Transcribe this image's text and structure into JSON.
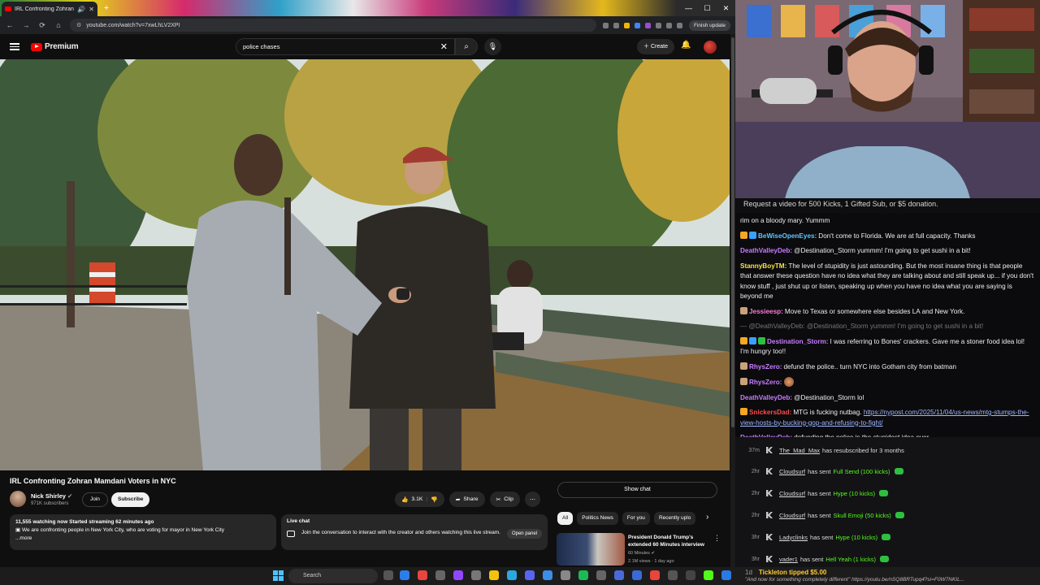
{
  "browser": {
    "tab_title": "IRL Confronting Zohran Ma",
    "url": "youtube.com/watch?v=7xwLhLV2XPI",
    "finish_update": "Finish update"
  },
  "youtube": {
    "logo_text": "Premium",
    "search_value": "police chases",
    "create_label": "Create",
    "video_title": "IRL Confronting Zohran Mamdani Voters in NYC",
    "channel_name": "Nick Shirley",
    "channel_subs": "971K subscribers",
    "join_label": "Join",
    "subscribe_label": "Subscribe",
    "likes": "3.1K",
    "share_label": "Share",
    "clip_label": "Clip",
    "desc_meta": "11,555 watching now  Started streaming 62 minutes ago",
    "desc_text": "We are confronting people in New York City, who are voting for mayor in New York City",
    "desc_more": "...more",
    "livechat_title": "Live chat",
    "livechat_text": "Join the conversation to interact with the creator and others watching this live stream.",
    "open_panel": "Open panel",
    "show_chat": "Show chat",
    "chips": [
      "All",
      "Politics News",
      "For you",
      "Recently uplo"
    ],
    "rec_title": "President Donald Trump's extended 60 Minutes interview",
    "rec_channel": "60 Minutes",
    "rec_views": "2.1M views · 1 day ago"
  },
  "banner_text": "Request a video for 500 Kicks, 1 Gifted Sub, or $5 donation.",
  "chat": [
    {
      "user": "",
      "color": "#efeff1",
      "text": "rim on a bloody mary. Yummm",
      "badges": []
    },
    {
      "user": "BeWiseOpenEyes:",
      "color": "#5ec8ff",
      "text": "Don't come to Florida. We are at full capacity. Thanks",
      "badges": [
        "#f5a623",
        "#3aa0ff"
      ]
    },
    {
      "user": "DeathValleyDeb:",
      "color": "#c77dff",
      "text": "@Destination_Storm yummm! I'm going to get sushi in a bit!",
      "badges": []
    },
    {
      "user": "StannyBoyTM:",
      "color": "#f8e34a",
      "text": "The level of stupidity is just astounding. But the most insane thing is that people that answer these question have no idea what they are talking about and still speak up... if you don't know stuff , just shut up or listen, speaking up when you have no idea what you are saying is beyond me",
      "badges": []
    },
    {
      "user": "Jessieesp:",
      "color": "#ff77d9",
      "text": "Move to Texas or somewhere else besides LA and New York.",
      "badges": [
        "#c9a27a"
      ]
    },
    {
      "user": "",
      "color": "#777",
      "text": "— @DeathValleyDeb: @Destination_Storm yummm! I'm going to get sushi in a bit!",
      "badges": [],
      "dim": true
    },
    {
      "user": "Destination_Storm:",
      "color": "#c77dff",
      "text": "I was referring to Bones' crackers. Gave me a stoner food idea lol! I'm hungry too!!",
      "badges": [
        "#f5a623",
        "#3aa0ff",
        "#2fbf3f"
      ]
    },
    {
      "user": "RhysZero:",
      "color": "#c77dff",
      "text": "defund the police.. turn NYC into Gotham city from batman",
      "badges": [
        "#c9a27a"
      ]
    },
    {
      "user": "RhysZero:",
      "color": "#c77dff",
      "text": "",
      "badges": [
        "#c9a27a"
      ],
      "emote": true
    },
    {
      "user": "DeathValleyDeb:",
      "color": "#c77dff",
      "text": "@Destination_Storm lol",
      "badges": []
    },
    {
      "user": "SnickersDad:",
      "color": "#ff4a4a",
      "text": "MTG is fucking nutbag.",
      "link": "https://nypost.com/2025/11/04/us-news/mtg-stumps-the-view-hosts-by-bucking-gop-and-refusing-to-fight/",
      "badges": [
        "#f5a623"
      ]
    },
    {
      "user": "DeathValleyDeb:",
      "color": "#c77dff",
      "text": "defunding the police is the stupidest idea ever",
      "badges": []
    }
  ],
  "feed": [
    {
      "time": "37m",
      "user": "The_Mad_Max",
      "action": "has resubscribed for 3 months",
      "item": "",
      "gem": false
    },
    {
      "time": "2hr",
      "user": "Cloudsurf",
      "action": "has sent",
      "item": "Full Send (100 kicks)",
      "gem": true
    },
    {
      "time": "2hr",
      "user": "Cloudsurf",
      "action": "has sent",
      "item": "Hype (10 kicks)",
      "gem": true
    },
    {
      "time": "2hr",
      "user": "Cloudsurf",
      "action": "has sent",
      "item": "Skull Emoji (50 kicks)",
      "gem": true
    },
    {
      "time": "3hr",
      "user": "Ladyclinks",
      "action": "has sent",
      "item": "Hype (10 kicks)",
      "gem": true
    },
    {
      "time": "3hr",
      "user": "vader1",
      "action": "has sent",
      "item": "Hell Yeah (1 kicks)",
      "gem": true
    }
  ],
  "tip": {
    "time": "1d",
    "label": "Tickleton tipped $5.00",
    "quote": "\"And now for something completely different\" https://youtu.be/nSQ8BRTupq4?si=F0W7NKIL..."
  },
  "taskbar": {
    "search_placeholder": "Search"
  }
}
